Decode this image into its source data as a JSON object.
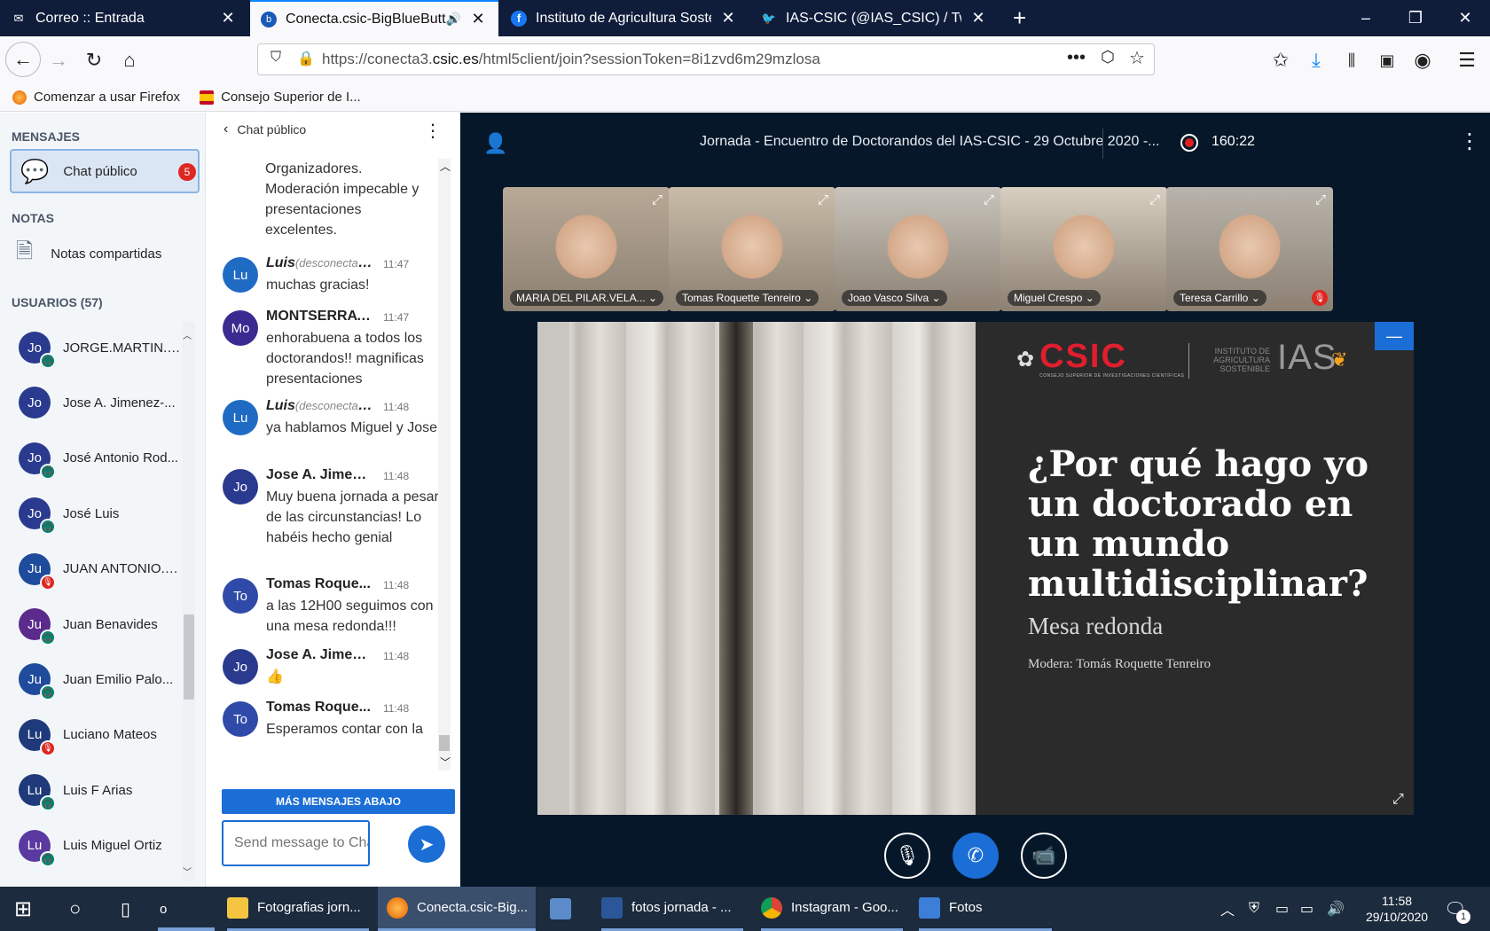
{
  "browser": {
    "tabs": [
      {
        "label": "Correo :: Entrada",
        "active": false
      },
      {
        "label": "Conecta.csic-BigBlueButton",
        "active": true
      },
      {
        "label": "Instituto de Agricultura Sostenible",
        "active": false
      },
      {
        "label": "IAS-CSIC (@IAS_CSIC) / Twitter",
        "active": false
      }
    ],
    "new_tab": "+",
    "url_prefix": "https://conecta3.",
    "url_domain": "csic.es",
    "url_path": "/html5client/join?sessionToken=8i1zvd6m29mzlosa",
    "bookmarks": [
      "Comenzar a usar Firefox",
      "Consejo Superior de I..."
    ]
  },
  "sidebar": {
    "messages_heading": "MENSAJES",
    "public_chat_label": "Chat público",
    "unread_count": "5",
    "notes_heading": "NOTAS",
    "shared_notes_label": "Notas compartidas",
    "users_heading": "USUARIOS (57)",
    "users": [
      {
        "initials": "Jo",
        "name": "JORGE.MARTIN.B...",
        "color": "#2a3a8f",
        "status": "listen"
      },
      {
        "initials": "Jo",
        "name": "Jose A. Jimenez-...",
        "color": "#2a3a8f",
        "status": "none"
      },
      {
        "initials": "Jo",
        "name": "José Antonio Rod...",
        "color": "#2a3a8f",
        "status": "listen"
      },
      {
        "initials": "Jo",
        "name": "José Luis",
        "color": "#2a3a8f",
        "status": "listen"
      },
      {
        "initials": "Ju",
        "name": "JUAN ANTONIO.N...",
        "color": "#1f4b9c",
        "status": "muted"
      },
      {
        "initials": "Ju",
        "name": "Juan Benavides",
        "color": "#5a2a8c",
        "status": "listen"
      },
      {
        "initials": "Ju",
        "name": "Juan Emilio Palo...",
        "color": "#1f4b9c",
        "status": "listen"
      },
      {
        "initials": "Lu",
        "name": "Luciano Mateos",
        "color": "#1f3a7a",
        "status": "muted"
      },
      {
        "initials": "Lu",
        "name": "Luis F Arias",
        "color": "#1f3a7a",
        "status": "listen"
      },
      {
        "initials": "Lu",
        "name": "Luis Miguel Ortiz",
        "color": "#5a3aa0",
        "status": "listen"
      }
    ]
  },
  "chat": {
    "header": "Chat público",
    "first_msg_tail": "Organizadores. Moderación impecable y presentaciones excelentes.",
    "messages": [
      {
        "initials": "Lu",
        "author": "Luis",
        "disconnected": "(desconectado)",
        "time": "11:47",
        "text": "muchas gracias!",
        "color": "#1f6bc4"
      },
      {
        "initials": "Mo",
        "author": "MONTSERRAT...",
        "disconnected": "",
        "time": "11:47",
        "text": "enhorabuena a todos los doctorandos!! magnificas presentaciones",
        "color": "#3b2a8f"
      },
      {
        "initials": "Lu",
        "author": "Luis",
        "disconnected": "(desconectado)",
        "time": "11:48",
        "text": "ya hablamos Miguel y Jose",
        "color": "#1f6bc4"
      },
      {
        "initials": "Jo",
        "author": "Jose A. Jimen...",
        "disconnected": "",
        "time": "11:48",
        "text": "Muy buena jornada a pesar de las circunstancias! Lo habéis hecho genial",
        "color": "#2a3a8f"
      },
      {
        "initials": "To",
        "author": "Tomas Roque...",
        "disconnected": "",
        "time": "11:48",
        "text": "a las 12H00 seguimos con una mesa redonda!!!",
        "color": "#2f4aa8"
      },
      {
        "initials": "Jo",
        "author": "Jose A. Jimen...",
        "disconnected": "",
        "time": "11:48",
        "text": "👍",
        "color": "#2a3a8f"
      },
      {
        "initials": "To",
        "author": "Tomas Roque...",
        "disconnected": "",
        "time": "11:48",
        "text": "Esperamos contar con la",
        "color": "#2f4aa8"
      }
    ],
    "more_below": "MÁS MENSAJES ABAJO",
    "input_placeholder": "Send message to Chat"
  },
  "meeting": {
    "title": "Jornada - Encuentro de Doctorandos del IAS-CSIC - 29 Octubre 2020 -...",
    "timer": "160:22",
    "webcams": [
      {
        "name": "MARIA DEL PILAR.VELA...",
        "bg": "#b8a896"
      },
      {
        "name": "Tomas Roquette Tenreiro",
        "bg": "#c9bca8"
      },
      {
        "name": "Joao Vasco Silva",
        "bg": "#c8c4bc"
      },
      {
        "name": "Miguel Crespo",
        "bg": "#d8cfc0"
      },
      {
        "name": "Teresa Carrillo",
        "bg": "#b9b4ac"
      }
    ],
    "slide": {
      "logo_text": "CSIC",
      "logo_sub": "CONSEJO SUPERIOR DE INVESTIGACIONES CIENTÍFICAS",
      "ias_sub": "INSTITUTO DE AGRICULTURA SOSTENIBLE",
      "ias_text": "IAS",
      "question": "¿Por qué hago yo un doctorado en un mundo multidisciplinar?",
      "subtitle": "Mesa redonda",
      "moderator": "Modera: Tomás Roquette Tenreiro"
    }
  },
  "taskbar": {
    "items": [
      "Fotografias jorn...",
      "Conecta.csic-Big...",
      "",
      "fotos jornada - ...",
      "Instagram - Goo...",
      "Fotos"
    ],
    "search_char": "o",
    "time": "11:58",
    "date": "29/10/2020",
    "notif_count": "1"
  }
}
